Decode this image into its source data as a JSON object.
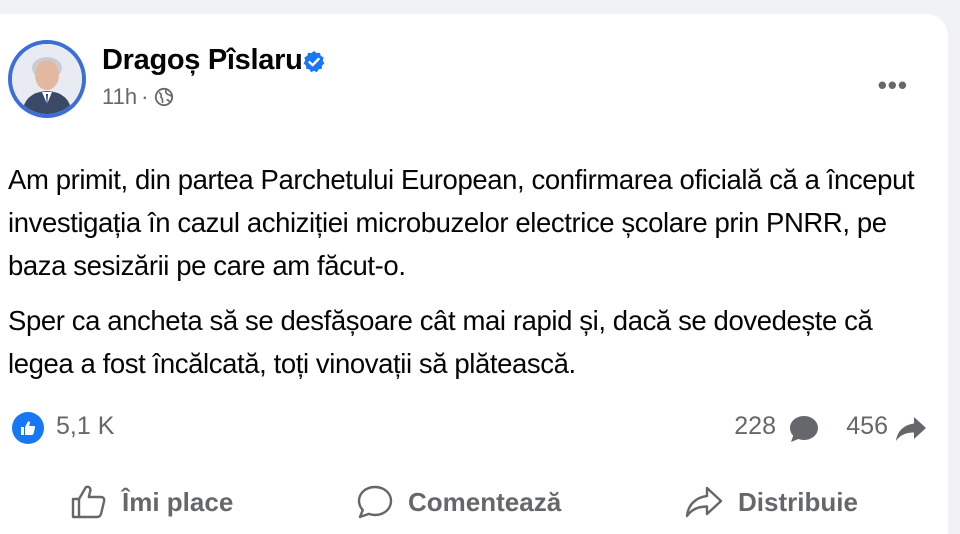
{
  "post": {
    "author": "Dragoș Pîslaru",
    "verified_icon": "verified-badge-icon",
    "time": "11h",
    "separator": "·",
    "audience_icon": "globe-icon",
    "more_label": "•••",
    "paragraphs": [
      "Am primit, din partea Parchetului European, confirmarea oficială că a început investigația în cazul achiziției microbuzelor electrice școlare prin PNRR, pe baza sesizării pe care am făcut-o.",
      "Sper ca ancheta să se desfășoare cât mai rapid și, dacă se dovedește că legea a fost încălcată, toți vinovații să plătească."
    ]
  },
  "stats": {
    "reactions": "5,1 K",
    "comments": "228",
    "shares": "456"
  },
  "actions": {
    "like": "Îmi place",
    "comment": "Comentează",
    "share": "Distribuie"
  },
  "colors": {
    "brand_blue": "#1877f2",
    "secondary_text": "#65676b",
    "primary_text": "#050505",
    "background": "#f0f2f5"
  }
}
